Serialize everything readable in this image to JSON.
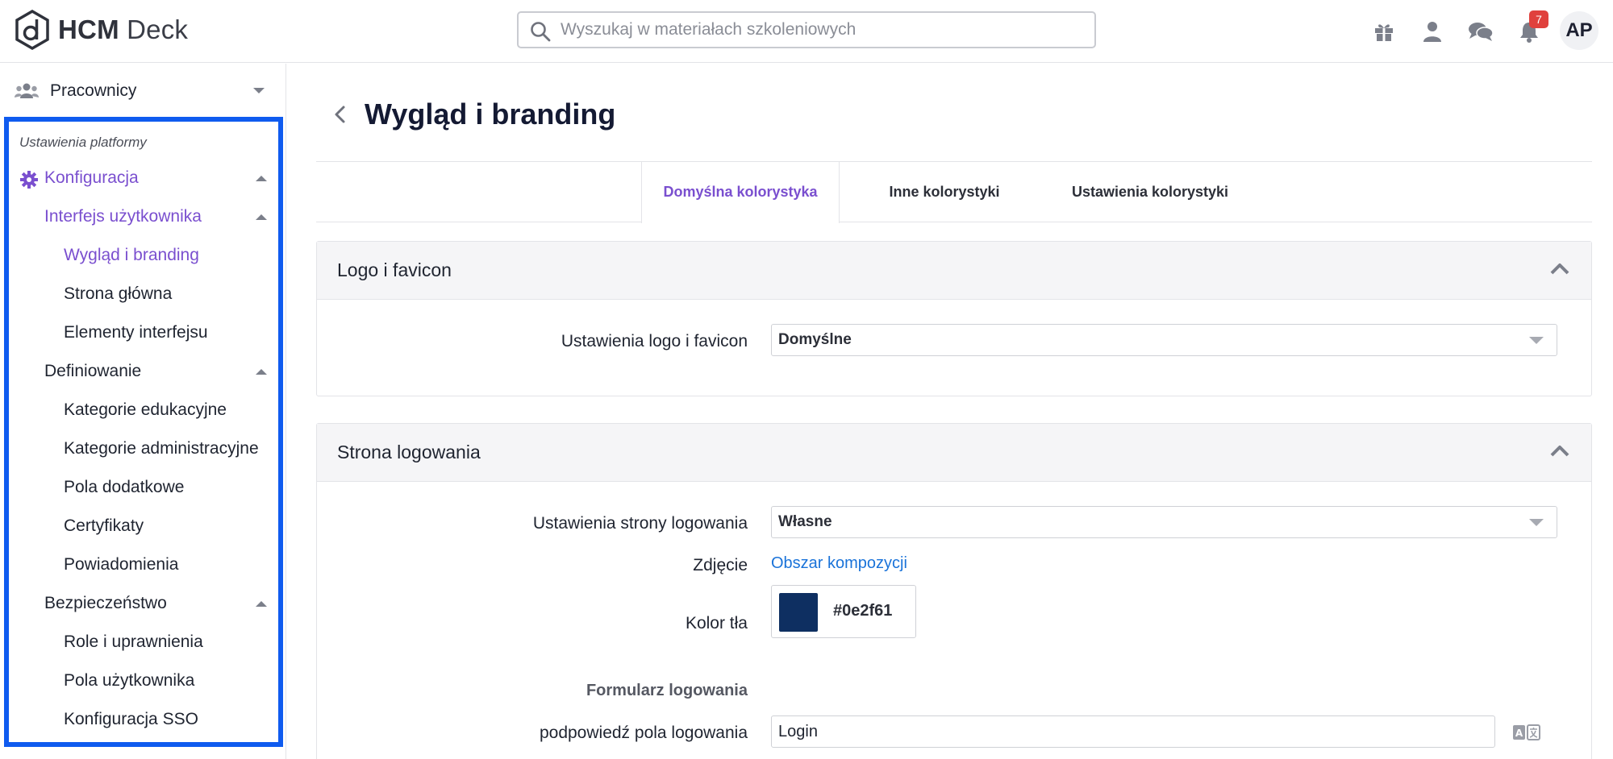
{
  "app": {
    "logo_bold": "HCM",
    "logo_rest": "Deck"
  },
  "search": {
    "placeholder": "Wyszukaj w materiałach szkoleniowych"
  },
  "header": {
    "notifications_count": "7",
    "avatar_initials": "AP",
    "icons": [
      "gift-icon",
      "user-icon",
      "chat-icon",
      "bell-icon"
    ]
  },
  "sidebar": {
    "employees_label": "Pracownicy",
    "section_title": "Ustawienia platformy",
    "config_label": "Konfiguracja",
    "groups": [
      {
        "label": "Interfejs użytkownika",
        "items": [
          "Wygląd i branding",
          "Strona główna",
          "Elementy interfejsu"
        ]
      },
      {
        "label": "Definiowanie",
        "items": [
          "Kategorie edukacyjne",
          "Kategorie administracyjne",
          "Pola dodatkowe",
          "Certyfikaty",
          "Powiadomienia"
        ]
      },
      {
        "label": "Bezpieczeństwo",
        "items": [
          "Role i uprawnienia",
          "Pola użytkownika",
          "Konfiguracja SSO"
        ]
      }
    ],
    "active_item": "Wygląd i branding",
    "colors": {
      "active": "#7a4fcf",
      "highlight_border": "#0f5bef"
    }
  },
  "main": {
    "title": "Wygląd i branding",
    "tabs": [
      {
        "label": "Domyślna kolorystyka",
        "active": true
      },
      {
        "label": "Inne kolorystyki",
        "active": false
      },
      {
        "label": "Ustawienia kolorystyki",
        "active": false
      }
    ],
    "logo_panel": {
      "title": "Logo i favicon",
      "setting_label": "Ustawienia logo i favicon",
      "setting_value": "Domyślne"
    },
    "login_panel": {
      "title": "Strona logowania",
      "setting_label": "Ustawienia strony logowania",
      "setting_value": "Własne",
      "photo_label": "Zdjęcie",
      "photo_link": "Obszar kompozycji",
      "bg_color_label": "Kolor tła",
      "bg_color_value": "#0e2f61",
      "form_heading": "Formularz logowania",
      "login_hint_label": "podpowiedź pola logowania",
      "login_hint_value": "Login"
    }
  }
}
